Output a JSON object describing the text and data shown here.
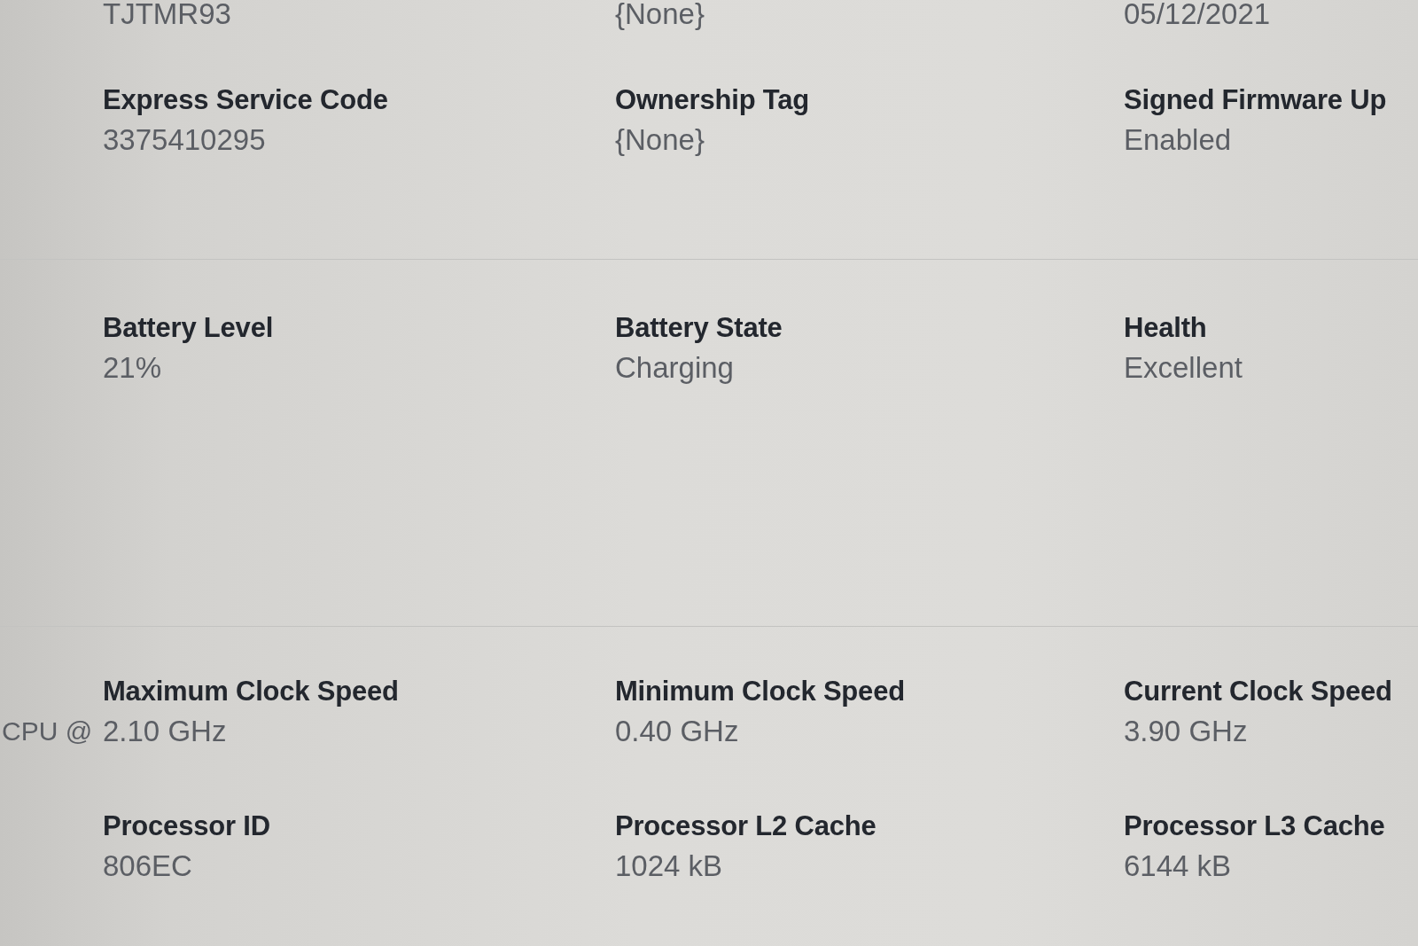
{
  "top_row": [
    {
      "value": "TJTMR93"
    },
    {
      "value": "{None}"
    },
    {
      "value": "05/12/2021"
    }
  ],
  "sections": [
    {
      "rows": [
        [
          {
            "label": "Express Service Code",
            "value": "3375410295"
          },
          {
            "label": "Ownership Tag",
            "value": "{None}"
          },
          {
            "label": "Signed Firmware Up",
            "value": "Enabled"
          }
        ]
      ]
    },
    {
      "rows": [
        [
          {
            "label": "Battery Level",
            "value": "21%"
          },
          {
            "label": "Battery State",
            "value": "Charging"
          },
          {
            "label": "Health",
            "value": "Excellent"
          }
        ]
      ]
    },
    {
      "lead_value": "CPU @",
      "rows": [
        [
          {
            "label": "Maximum Clock Speed",
            "value": "2.10 GHz"
          },
          {
            "label": "Minimum Clock Speed",
            "value": "0.40 GHz"
          },
          {
            "label": "Current Clock Speed",
            "value": "3.90 GHz"
          }
        ],
        [
          {
            "label": "Processor ID",
            "value": "806EC"
          },
          {
            "label": "Processor L2 Cache",
            "value": "1024 kB"
          },
          {
            "label": "Processor L3 Cache",
            "value": "6144 kB"
          }
        ]
      ]
    }
  ]
}
